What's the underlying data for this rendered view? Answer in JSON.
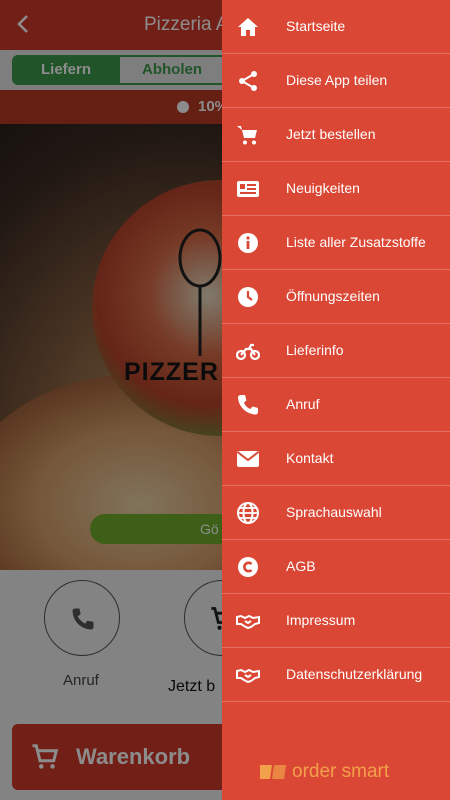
{
  "header": {
    "title": "Pizzeria A",
    "back_icon": "chevron-left-icon"
  },
  "order_mode": {
    "deliver": "Liefern",
    "pickup": "Abholen"
  },
  "discount": {
    "text": "10%"
  },
  "hero": {
    "logo_text": "PIZZER",
    "open_status": "Gö"
  },
  "actions": {
    "call_label": "Anruf",
    "order_label": "Jetzt b"
  },
  "cart": {
    "label": "Warenkorb"
  },
  "drawer": {
    "items": [
      {
        "label": "Startseite",
        "icon": "home-icon"
      },
      {
        "label": "Diese App teilen",
        "icon": "share-icon"
      },
      {
        "label": "Jetzt bestellen",
        "icon": "cart-icon"
      },
      {
        "label": "Neuigkeiten",
        "icon": "news-icon"
      },
      {
        "label": "Liste aller Zusatzstoffe",
        "icon": "info-icon"
      },
      {
        "label": "Öffnungszeiten",
        "icon": "clock-icon"
      },
      {
        "label": "Lieferinfo",
        "icon": "motorcycle-icon"
      },
      {
        "label": "Anruf",
        "icon": "phone-icon"
      },
      {
        "label": "Kontakt",
        "icon": "mail-icon"
      },
      {
        "label": "Sprachauswahl",
        "icon": "globe-icon"
      },
      {
        "label": "AGB",
        "icon": "copyright-icon"
      },
      {
        "label": "Impressum",
        "icon": "handshake-icon"
      },
      {
        "label": "Datenschutzerklärung",
        "icon": "handshake-icon"
      }
    ],
    "brand": "order smart"
  },
  "colors": {
    "primary": "#db4735",
    "header": "#cf3a2a",
    "green": "#3c9a4a",
    "brand": "#f2a04a"
  }
}
